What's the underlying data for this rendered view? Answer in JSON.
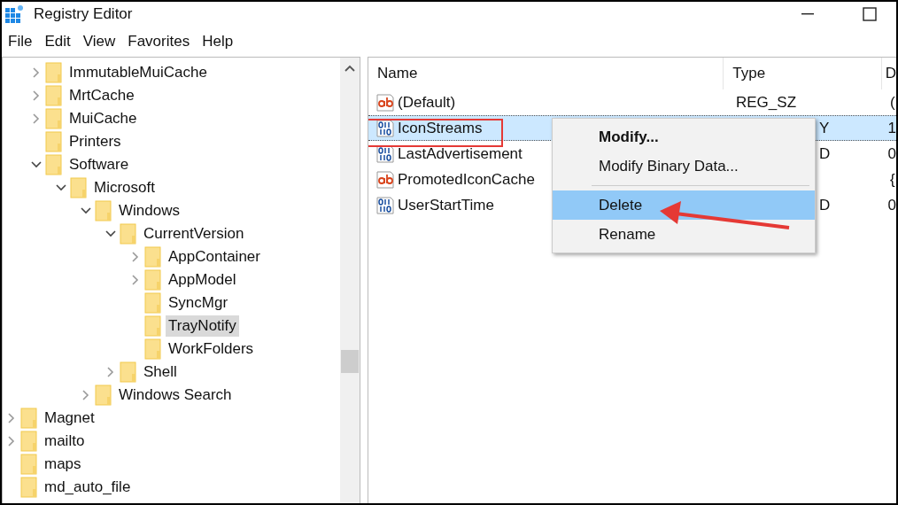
{
  "window": {
    "title": "Registry Editor"
  },
  "menu": [
    "File",
    "Edit",
    "View",
    "Favorites",
    "Help"
  ],
  "tree": {
    "continued": [
      {
        "label": "ImmutableMuiCache",
        "expandable": true,
        "expanded": false,
        "selected": false
      },
      {
        "label": "MrtCache",
        "expandable": true,
        "expanded": false,
        "selected": false
      },
      {
        "label": "MuiCache",
        "expandable": true,
        "expanded": false,
        "selected": false
      },
      {
        "label": "Printers",
        "expandable": false,
        "selected": false
      },
      {
        "label": "Software",
        "expandable": true,
        "expanded": true,
        "selected": false,
        "children": [
          {
            "label": "Microsoft",
            "expandable": true,
            "expanded": true,
            "selected": false,
            "children": [
              {
                "label": "Windows",
                "expandable": true,
                "expanded": true,
                "selected": false,
                "children": [
                  {
                    "label": "CurrentVersion",
                    "expandable": true,
                    "expanded": true,
                    "selected": false,
                    "children": [
                      {
                        "label": "AppContainer",
                        "expandable": true,
                        "expanded": false,
                        "selected": false
                      },
                      {
                        "label": "AppModel",
                        "expandable": true,
                        "expanded": false,
                        "selected": false
                      },
                      {
                        "label": "SyncMgr",
                        "expandable": false,
                        "selected": false
                      },
                      {
                        "label": "TrayNotify",
                        "expandable": false,
                        "selected": true
                      },
                      {
                        "label": "WorkFolders",
                        "expandable": false,
                        "selected": false
                      }
                    ]
                  },
                  {
                    "label": "Shell",
                    "expandable": true,
                    "expanded": false,
                    "selected": false
                  }
                ]
              },
              {
                "label": "Windows Search",
                "expandable": true,
                "expanded": false,
                "selected": false
              }
            ]
          }
        ]
      }
    ],
    "items": [
      {
        "label": "Magnet",
        "expandable": true,
        "expanded": false,
        "selected": false
      },
      {
        "label": "mailto",
        "expandable": true,
        "expanded": false,
        "selected": false
      },
      {
        "label": "maps",
        "expandable": false,
        "selected": false
      },
      {
        "label": "md_auto_file",
        "expandable": false,
        "selected": false
      }
    ]
  },
  "values": {
    "columns": [
      "Name",
      "Type",
      "D"
    ],
    "rows": [
      {
        "kind": "string",
        "name": "(Default)",
        "type": "REG_SZ",
        "column_3": "(",
        "selected": false
      },
      {
        "kind": "binary",
        "name": "IconStreams",
        "type": "Y",
        "column_3": "1",
        "selected": true
      },
      {
        "kind": "binary",
        "name": "LastAdvertisement",
        "type": "D",
        "column_3": "0",
        "selected": false
      },
      {
        "kind": "string",
        "name": "PromotedIconCache",
        "type": "",
        "column_3": "{",
        "selected": false
      },
      {
        "kind": "binary",
        "name": "UserStartTime",
        "type": "D",
        "column_3": "0",
        "selected": false
      }
    ]
  },
  "context_menu": [
    {
      "label": "Modify...",
      "default": true,
      "separator_before": false,
      "selected": false
    },
    {
      "label": "Modify Binary Data...",
      "default": false,
      "separator_before": false,
      "selected": false
    },
    {
      "label": "Delete",
      "default": false,
      "separator_before": true,
      "selected": true
    },
    {
      "label": "Rename",
      "default": false,
      "separator_before": false,
      "selected": false
    }
  ]
}
